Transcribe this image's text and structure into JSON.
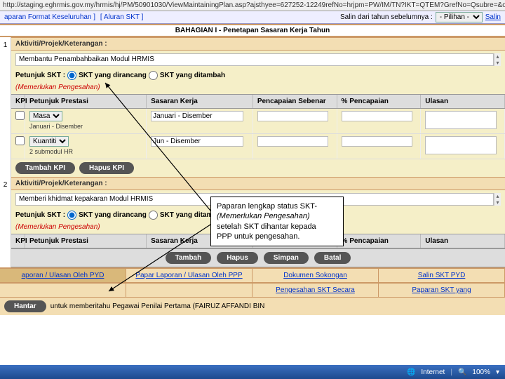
{
  "url": "http://staging.eghrmis.gov.my/hrmis/hj/PM/50901030/ViewMaintainingPlan.asp?ajsthyee=627252-12249refNo=hrjpm=PW/IM/TN?IKT=QTEM?GrefNo=Qsubre=&onprsubre=403dnt;2121;2;2;72;521;;2;c",
  "header": {
    "left_link1": "aparan Format Keseluruhan ]",
    "left_link2": "[ Aluran SKT ]",
    "right_label": "Salin dari tahun sebelumnya :",
    "right_option": "- Pilihan -",
    "right_action": "Salin"
  },
  "section_title": "BAHAGIAN I - Penetapan Sasaran Kerja Tahun",
  "row1": {
    "num": "1",
    "activity_label": "Aktiviti/Projek/Keterangan :",
    "activity_text": "Membantu Penambahbaikan Modul HRMIS",
    "petunjuk_label": "Petunjuk SKT :",
    "radio1": "SKT yang dirancang",
    "radio2": "SKT yang ditambah",
    "status": "(Memerlukan Pengesahan)"
  },
  "kpi_headers": {
    "kpi": "KPI",
    "pp": "Petunjuk Prestasi",
    "sk": "Sasaran Kerja",
    "ps": "Pencapaian Sebenar",
    "pc": "% Pencapaian",
    "ul": "Ulasan"
  },
  "kpi_rows": [
    {
      "checked": false,
      "pp_sel": "Masa",
      "pp_sub": "Januari - Disember",
      "sk": "Januari - Disember"
    },
    {
      "checked": false,
      "pp_sel": "Kuantiti",
      "pp_sub": "2 submodul HR",
      "sk": "Jun - Disember"
    }
  ],
  "buttons": {
    "tambah_kpi": "Tambah KPI",
    "hapus_kpi": "Hapus KPI",
    "tambah": "Tambah",
    "hapus": "Hapus",
    "simpan": "Simpan",
    "batal": "Batal",
    "hantar": "Hantar"
  },
  "row2": {
    "num": "2",
    "activity_label": "Aktiviti/Projek/Keterangan :",
    "activity_text": "Memberi khidmat kepakaran Modul HRMIS",
    "petunjuk_label": "Petunjuk SKT :",
    "radio1": "SKT yang dirancang",
    "radio2": "SKT yang ditambah",
    "status": "(Memerlukan Pengesahan)"
  },
  "bottom_tabs": {
    "t1": "aporan / Ulasan Oleh PYD",
    "t2": "Papar Laporan / Ulasan Oleh PPP",
    "t3": "Dokumen Sokongan",
    "t4": "Salin SKT PYD"
  },
  "bottom_tabs2": {
    "t3": "Pengesahan SKT Secara",
    "t4": "Paparan SKT yang"
  },
  "hantar_note": "untuk memberitahu Pegawai Penilai Pertama (FAIRUZ AFFANDI BIN",
  "status_bar": {
    "left": "",
    "internet": "Internet",
    "zoom": "100%"
  },
  "callout": {
    "l1": "Paparan lengkap status SKT-",
    "l2": "(Memerlukan Pengesahan)",
    "l3": "setelah SKT dihantar kepada",
    "l4": "PPP untuk pengesahan."
  }
}
